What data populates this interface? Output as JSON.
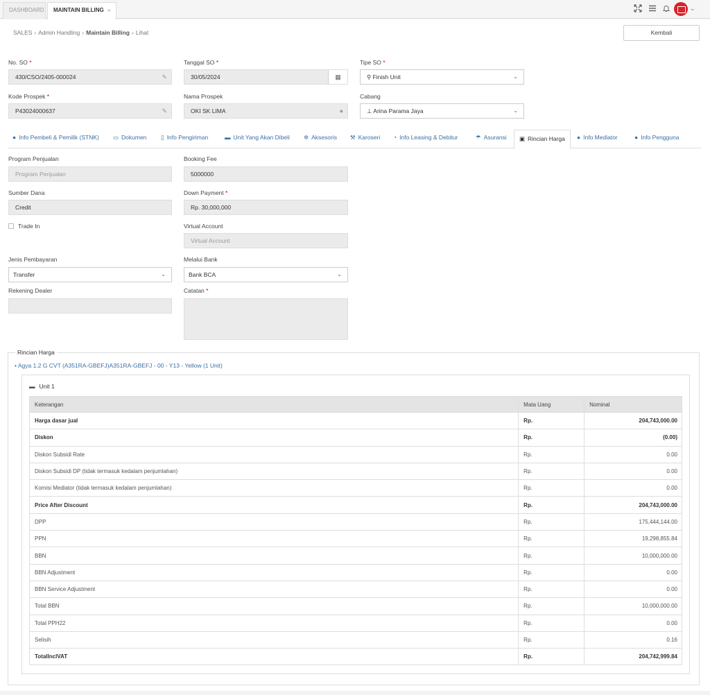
{
  "topbar": {
    "tabs": [
      {
        "label": "DASHBOARD"
      },
      {
        "label": "MAINTAIN BILLING",
        "close": "×"
      }
    ],
    "icons": [
      "expand-icon",
      "menu-icon",
      "bell-icon",
      "user-avatar-icon"
    ]
  },
  "breadcrumb": {
    "items": [
      "SALES",
      "Admin Handling",
      "Maintain Billing",
      "Lihat"
    ]
  },
  "kembali_label": "Kembali",
  "form": {
    "no_so": {
      "label": "No. SO",
      "value": "430/CSO/2405-000024"
    },
    "tanggal_so": {
      "label": "Tanggal SO",
      "value": "30/05/2024"
    },
    "tipe_so": {
      "label": "Tipe SO",
      "value": "Finish Unit"
    },
    "kode_prospek": {
      "label": "Kode Prospek",
      "value": "P43024000637"
    },
    "nama_prospek": {
      "label": "Nama Prospek",
      "value": "OKI SK LIMA"
    },
    "cabang": {
      "label": "Cabang",
      "value": "Arina Parama Jaya"
    }
  },
  "tabs": [
    {
      "label": "Info Pembeli & Pemilik (STNK)",
      "icon": "user-icon"
    },
    {
      "label": "Dokumen",
      "icon": "folder-icon"
    },
    {
      "label": "Info Pengiriman",
      "icon": "map-icon"
    },
    {
      "label": "Unit Yang Akan Dibeli",
      "icon": "car-icon"
    },
    {
      "label": "Aksesoris",
      "icon": "cogs-icon"
    },
    {
      "label": "Karoseri",
      "icon": "wrench-icon"
    },
    {
      "label": "Info Leasing & Debitur",
      "icon": "handshake-icon"
    },
    {
      "label": "Asuransi",
      "icon": "umbrella-icon"
    },
    {
      "label": "Rincian Harga",
      "icon": "money-icon"
    },
    {
      "label": "Info Mediator",
      "icon": "users-icon"
    },
    {
      "label": "Info Pengguna",
      "icon": "user-icon"
    }
  ],
  "detail": {
    "program_penjualan": {
      "label": "Program Penjualan",
      "placeholder": "Program Penjualan"
    },
    "booking_fee": {
      "label": "Booking Fee",
      "value": "5000000"
    },
    "sumber_dana": {
      "label": "Sumber Dana",
      "value": "Credit"
    },
    "down_payment": {
      "label": "Down Payment",
      "value": "Rp. 30,000,000"
    },
    "trade_in": {
      "label": "Trade In"
    },
    "virtual_account": {
      "label": "Virtual Account",
      "placeholder": "Virtual Account"
    },
    "jenis_pembayaran": {
      "label": "Jenis Pembayaran",
      "value": "Transfer"
    },
    "melalui_bank": {
      "label": "Melalui Bank",
      "value": "Bank BCA"
    },
    "rekening_dealer": {
      "label": "Rekening Dealer",
      "value": ""
    },
    "catatan": {
      "label": "Catatan",
      "value": ""
    }
  },
  "rincian": {
    "legend": "Rincian Harga",
    "item": "Agya 1.2 G CVT (A351RA-GBEFJ)A351RA-GBEFJ - 00 - Y13 - Yellow  (1 Unit)",
    "unit_title": "Unit 1",
    "headers": [
      "Keterangan",
      "Mata Uang",
      "Nominal"
    ],
    "rows": [
      {
        "k": "Harga dasar jual",
        "m": "Rp.",
        "n": "204,743,000.00",
        "bold": true
      },
      {
        "k": "Diskon",
        "m": "Rp.",
        "n": "(0.00)",
        "bold": true
      },
      {
        "k": "Diskon Subsidi Rate",
        "m": "Rp.",
        "n": "0.00",
        "bold": false
      },
      {
        "k": "Diskon Subsidi DP (tidak termasuk kedalam penjumlahan)",
        "m": "Rp.",
        "n": "0.00",
        "bold": false
      },
      {
        "k": "Komisi Mediator (tidak termasuk kedalam penjumlahan)",
        "m": "Rp.",
        "n": "0.00",
        "bold": false
      },
      {
        "k": "Price After Discount",
        "m": "Rp.",
        "n": "204,743,000.00",
        "bold": true
      },
      {
        "k": "DPP",
        "m": "Rp.",
        "n": "175,444,144.00",
        "bold": false
      },
      {
        "k": "PPN",
        "m": "Rp.",
        "n": "19,298,855.84",
        "bold": false
      },
      {
        "k": "BBN",
        "m": "Rp.",
        "n": "10,000,000.00",
        "bold": false
      },
      {
        "k": "BBN Adjustment",
        "m": "Rp.",
        "n": "0.00",
        "bold": false
      },
      {
        "k": "BBN Service Adjustment",
        "m": "Rp.",
        "n": "0.00",
        "bold": false
      },
      {
        "k": "Total BBN",
        "m": "Rp.",
        "n": "10,000,000.00",
        "bold": false
      },
      {
        "k": "Total PPH22",
        "m": "Rp.",
        "n": "0.00",
        "bold": false
      },
      {
        "k": "Selisih",
        "m": "Rp.",
        "n": "0.16",
        "bold": false
      },
      {
        "k": "TotalInclVAT",
        "m": "Rp.",
        "n": "204,742,999.84",
        "bold": true
      }
    ]
  }
}
